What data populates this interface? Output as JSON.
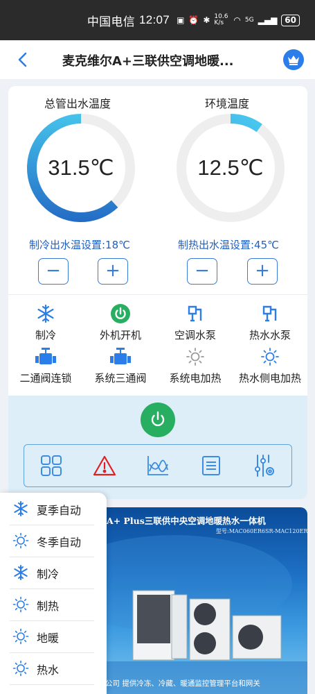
{
  "status_bar": {
    "carrier": "中国电信",
    "time": "12:07",
    "speed": "10.6 K/s",
    "network": "5G",
    "battery": "60"
  },
  "header": {
    "title": "麦克维尔A+三联供空调地暖...",
    "back_icon": "back-arrow-icon",
    "vip_icon": "crown-icon"
  },
  "gauges": [
    {
      "label": "总管出水温度",
      "value": "31.5℃",
      "level": 0.62,
      "setting": "制冷出水温设置:18℃"
    },
    {
      "label": "环境温度",
      "value": "12.5℃",
      "level": 0.1,
      "setting": "制热出水温设置:45℃"
    }
  ],
  "stepper": {
    "minus": "−",
    "plus": "+"
  },
  "functions": [
    {
      "label": "制冷",
      "icon": "snowflake-icon"
    },
    {
      "label": "外机开机",
      "icon": "power-green-icon"
    },
    {
      "label": "空调水泵",
      "icon": "pump-icon"
    },
    {
      "label": "热水水泵",
      "icon": "pump-icon"
    },
    {
      "label": "二通阀连锁",
      "icon": "valve-icon"
    },
    {
      "label": "系统三通阀",
      "icon": "valve-icon"
    },
    {
      "label": "系统电加热",
      "icon": "sun-icon"
    },
    {
      "label": "热水侧电加热",
      "icon": "sun-icon"
    }
  ],
  "toolbar": [
    "grid-icon",
    "warning-icon",
    "chart-icon",
    "list-icon",
    "settings-sliders-icon"
  ],
  "banner": {
    "title": "A+ Plus三联供中央空调地暖热水一体机",
    "model": "型号:MAC060ER6SR-MAC120ER6SR",
    "footer": "公司   提供冷冻、冷藏、暖通监控管理平台和网关"
  },
  "menu": [
    {
      "label": "夏季自动",
      "icon": "snowflake-icon"
    },
    {
      "label": "冬季自动",
      "icon": "sun-icon"
    },
    {
      "label": "制冷",
      "icon": "snowflake-icon"
    },
    {
      "label": "制热",
      "icon": "sun-icon"
    },
    {
      "label": "地暖",
      "icon": "sun-icon"
    },
    {
      "label": "热水",
      "icon": "sun-icon"
    }
  ],
  "colors": {
    "accent": "#2b7de9",
    "power": "#27ae60",
    "warning": "#e02020",
    "setting_text": "#1f5fc0"
  }
}
